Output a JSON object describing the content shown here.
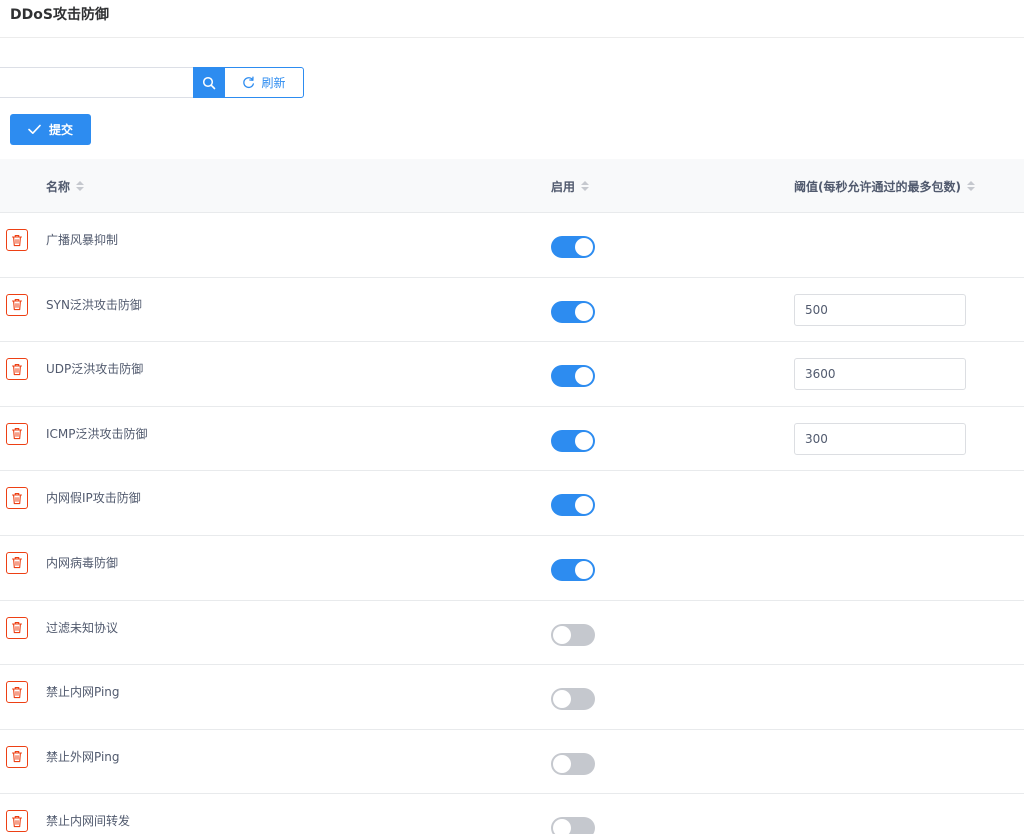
{
  "page": {
    "title": "DDoS攻击防御"
  },
  "toolbar": {
    "search_value": "",
    "refresh_label": "刷新",
    "submit_label": "提交"
  },
  "table": {
    "columns": {
      "name": "名称",
      "enabled": "启用",
      "threshold": "阈值(每秒允许通过的最多包数)"
    },
    "rows": [
      {
        "name": "广播风暴抑制",
        "enabled": true,
        "threshold": null
      },
      {
        "name": "SYN泛洪攻击防御",
        "enabled": true,
        "threshold": "500"
      },
      {
        "name": "UDP泛洪攻击防御",
        "enabled": true,
        "threshold": "3600"
      },
      {
        "name": "ICMP泛洪攻击防御",
        "enabled": true,
        "threshold": "300"
      },
      {
        "name": "内网假IP攻击防御",
        "enabled": true,
        "threshold": null
      },
      {
        "name": "内网病毒防御",
        "enabled": true,
        "threshold": null
      },
      {
        "name": "过滤未知协议",
        "enabled": false,
        "threshold": null
      },
      {
        "name": "禁止内网Ping",
        "enabled": false,
        "threshold": null
      },
      {
        "name": "禁止外网Ping",
        "enabled": false,
        "threshold": null
      },
      {
        "name": "禁止内网间转发",
        "enabled": false,
        "threshold": null
      }
    ]
  },
  "colors": {
    "primary": "#2d8cf0",
    "danger": "#ed4014",
    "switch_off": "#c5c8ce",
    "header_bg": "#f8f9fa"
  },
  "icons": {
    "search": "search-icon",
    "refresh": "refresh-icon",
    "submit": "check-icon",
    "delete": "trash-icon"
  }
}
